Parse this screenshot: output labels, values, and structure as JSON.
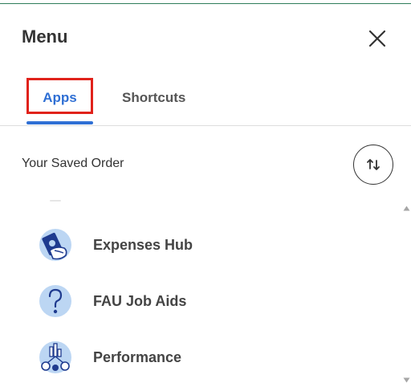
{
  "header": {
    "title": "Menu",
    "close_icon": "close-icon"
  },
  "tabs": [
    {
      "label": "Apps",
      "selected": true
    },
    {
      "label": "Shortcuts",
      "selected": false
    }
  ],
  "section": {
    "title": "Your Saved Order",
    "sort_icon": "sort-arrows-icon"
  },
  "apps": [
    {
      "label": "Expenses Hub",
      "icon": "expenses-hand-cash-icon"
    },
    {
      "label": "FAU Job Aids",
      "icon": "question-mark-icon"
    },
    {
      "label": "Performance",
      "icon": "performance-chart-people-icon"
    }
  ],
  "colors": {
    "accent": "#2f6fd4",
    "highlight_box": "#e0221b",
    "icon_light": "#bcd6f3",
    "icon_dark": "#1f3b8f"
  }
}
